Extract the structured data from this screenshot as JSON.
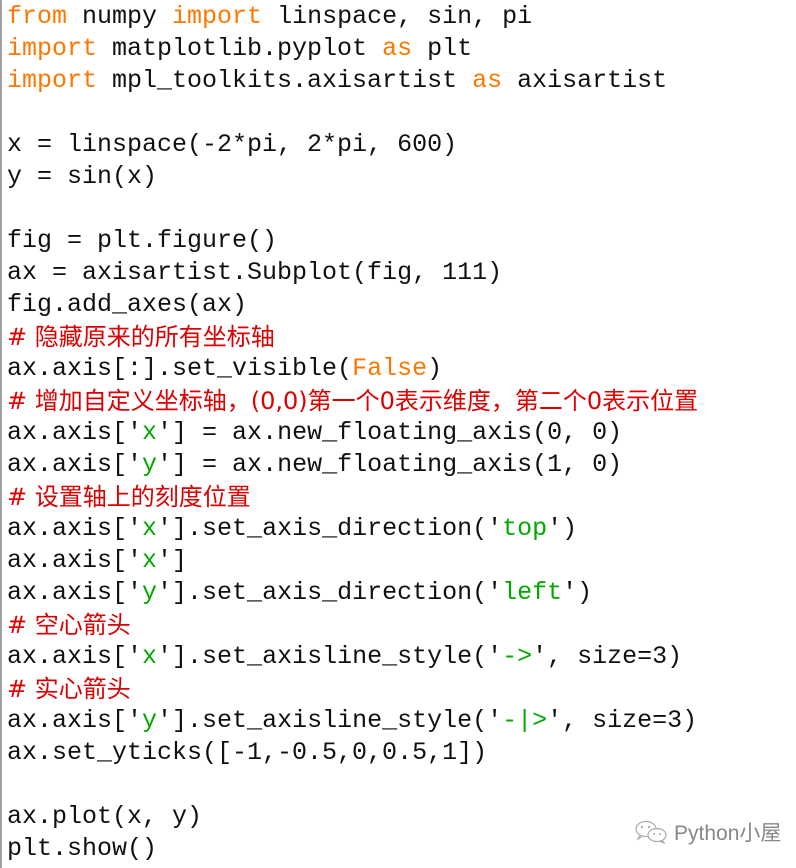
{
  "colors": {
    "keyword": "#ff7700",
    "comment": "#dd0000",
    "string": "#00aa00",
    "text": "#111111"
  },
  "code_lines": [
    [
      {
        "t": "kw",
        "v": "from"
      },
      {
        "t": "tx",
        "v": " numpy "
      },
      {
        "t": "kw",
        "v": "import"
      },
      {
        "t": "tx",
        "v": " linspace, sin, pi"
      }
    ],
    [
      {
        "t": "kw",
        "v": "import"
      },
      {
        "t": "tx",
        "v": " matplotlib.pyplot "
      },
      {
        "t": "kw",
        "v": "as"
      },
      {
        "t": "tx",
        "v": " plt"
      }
    ],
    [
      {
        "t": "kw",
        "v": "import"
      },
      {
        "t": "tx",
        "v": " mpl_toolkits.axisartist "
      },
      {
        "t": "kw",
        "v": "as"
      },
      {
        "t": "tx",
        "v": " axisartist"
      }
    ],
    [],
    [
      {
        "t": "tx",
        "v": "x = linspace(-2*pi, 2*pi, 600)"
      }
    ],
    [
      {
        "t": "tx",
        "v": "y = sin(x)"
      }
    ],
    [],
    [
      {
        "t": "tx",
        "v": "fig = plt.figure()"
      }
    ],
    [
      {
        "t": "tx",
        "v": "ax = axisartist.Subplot(fig, 111)"
      }
    ],
    [
      {
        "t": "tx",
        "v": "fig.add_axes(ax)"
      }
    ],
    [
      {
        "t": "cm",
        "v": "# 隐藏原来的所有坐标轴"
      }
    ],
    [
      {
        "t": "tx",
        "v": "ax.axis[:].set_visible("
      },
      {
        "t": "kw",
        "v": "False"
      },
      {
        "t": "tx",
        "v": ")"
      }
    ],
    [
      {
        "t": "cm",
        "v": "# 增加自定义坐标轴，(0,0)第一个0表示维度，第二个0表示位置"
      }
    ],
    [
      {
        "t": "tx",
        "v": "ax.axis['"
      },
      {
        "t": "st",
        "v": "x"
      },
      {
        "t": "tx",
        "v": "'] = ax.new_floating_axis(0, 0)"
      }
    ],
    [
      {
        "t": "tx",
        "v": "ax.axis['"
      },
      {
        "t": "st",
        "v": "y"
      },
      {
        "t": "tx",
        "v": "'] = ax.new_floating_axis(1, 0)"
      }
    ],
    [
      {
        "t": "cm",
        "v": "# 设置轴上的刻度位置"
      }
    ],
    [
      {
        "t": "tx",
        "v": "ax.axis['"
      },
      {
        "t": "st",
        "v": "x"
      },
      {
        "t": "tx",
        "v": "'].set_axis_direction('"
      },
      {
        "t": "st",
        "v": "top"
      },
      {
        "t": "tx",
        "v": "')"
      }
    ],
    [
      {
        "t": "tx",
        "v": "ax.axis['"
      },
      {
        "t": "st",
        "v": "x"
      },
      {
        "t": "tx",
        "v": "']"
      }
    ],
    [
      {
        "t": "tx",
        "v": "ax.axis['"
      },
      {
        "t": "st",
        "v": "y"
      },
      {
        "t": "tx",
        "v": "'].set_axis_direction('"
      },
      {
        "t": "st",
        "v": "left"
      },
      {
        "t": "tx",
        "v": "')"
      }
    ],
    [
      {
        "t": "cm",
        "v": "# 空心箭头"
      }
    ],
    [
      {
        "t": "tx",
        "v": "ax.axis['"
      },
      {
        "t": "st",
        "v": "x"
      },
      {
        "t": "tx",
        "v": "'].set_axisline_style('"
      },
      {
        "t": "st",
        "v": "->"
      },
      {
        "t": "tx",
        "v": "', size=3)"
      }
    ],
    [
      {
        "t": "cm",
        "v": "# 实心箭头"
      }
    ],
    [
      {
        "t": "tx",
        "v": "ax.axis['"
      },
      {
        "t": "st",
        "v": "y"
      },
      {
        "t": "tx",
        "v": "'].set_axisline_style('"
      },
      {
        "t": "st",
        "v": "-|>"
      },
      {
        "t": "tx",
        "v": "', size=3)"
      }
    ],
    [
      {
        "t": "tx",
        "v": "ax.set_yticks([-1,-0.5,0,0.5,1])"
      }
    ],
    [],
    [
      {
        "t": "tx",
        "v": "ax.plot(x, y)"
      }
    ],
    [
      {
        "t": "tx",
        "v": "plt.show()"
      }
    ]
  ],
  "watermark": {
    "icon": "wechat-icon",
    "text": "Python小屋"
  }
}
